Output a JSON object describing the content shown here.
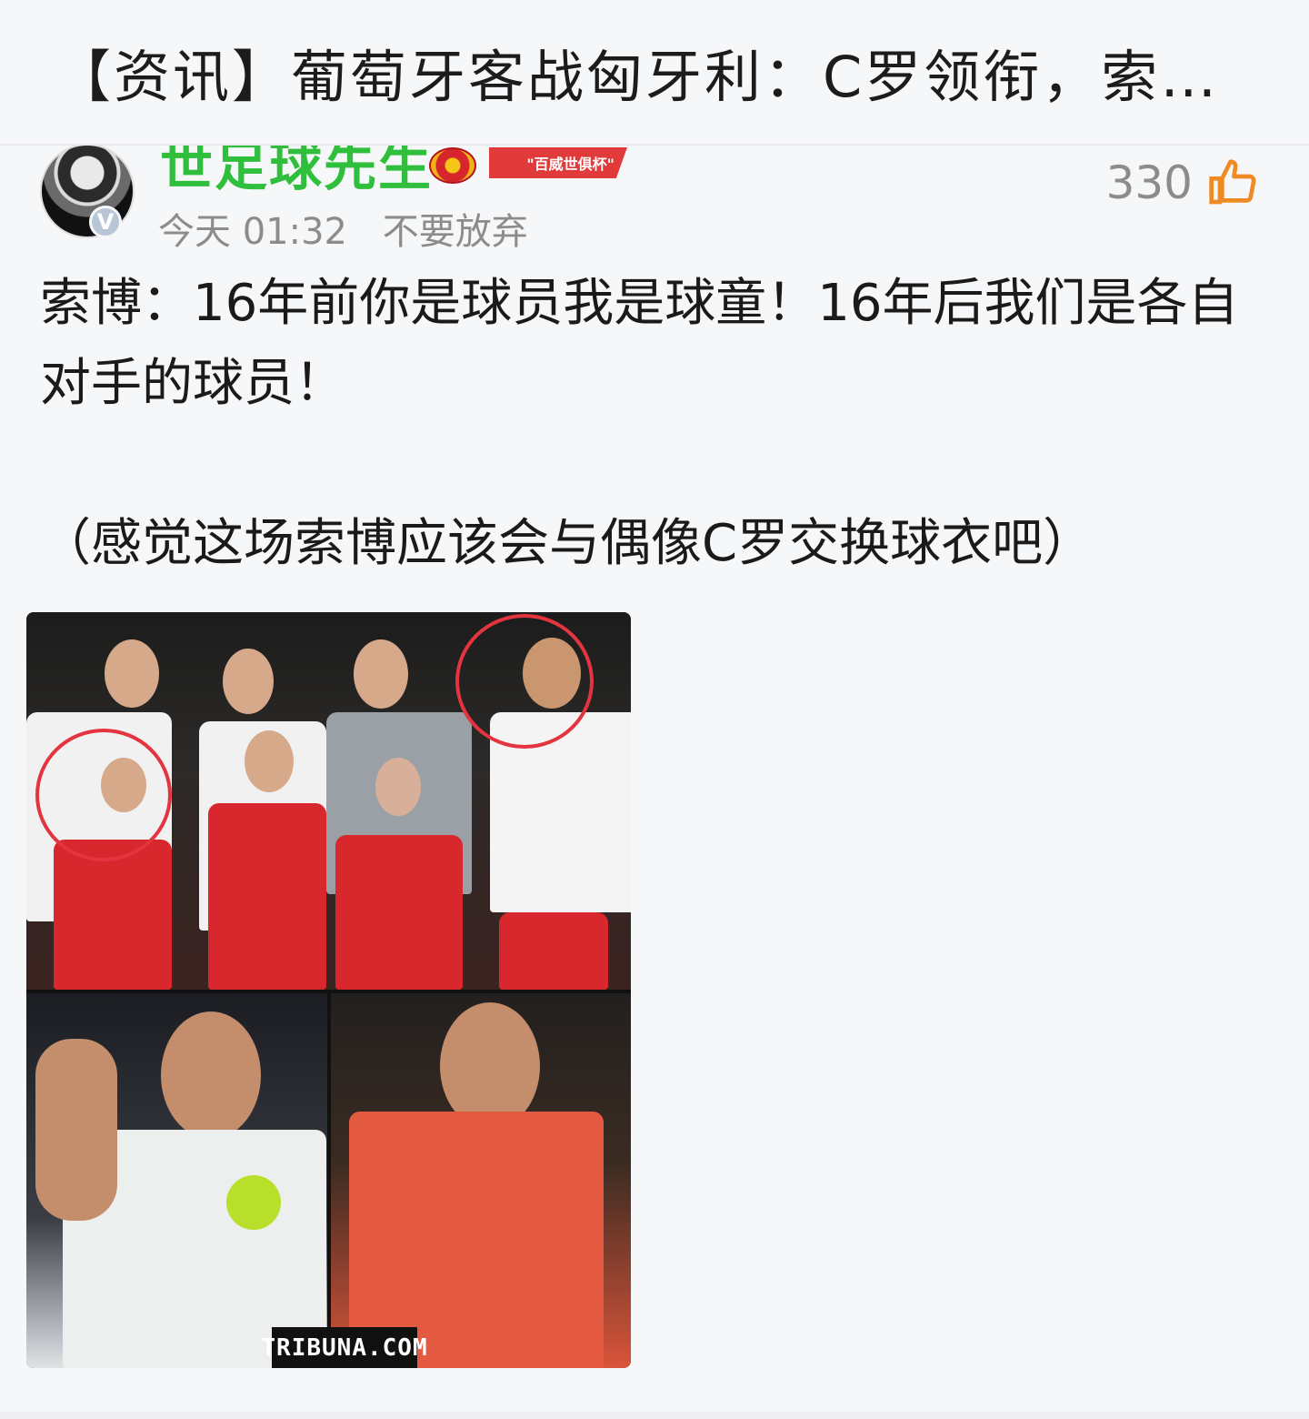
{
  "header": {
    "title": "【资讯】葡萄牙客战匈牙利：C罗领衔，索博..."
  },
  "post": {
    "author": {
      "name": "世足球先生",
      "verified_badge": "V",
      "medal_label": "\"百威世俱杯\""
    },
    "time": "今天 01:32",
    "signature": "不要放弃",
    "likes": "330",
    "body_line_1": "索博：16年前你是球员我是球童！16年后我们是各自对手的球员！",
    "body_line_2": "（感觉这场索博应该会与偶像C罗交换球衣吧）",
    "image": {
      "watermark": "TRIBUNA.COM"
    }
  },
  "colors": {
    "username": "#2fbf3c",
    "like_icon": "#f08a24",
    "highlight_ring": "#e3343f"
  },
  "icons": {
    "like": "thumbs-up-icon"
  }
}
